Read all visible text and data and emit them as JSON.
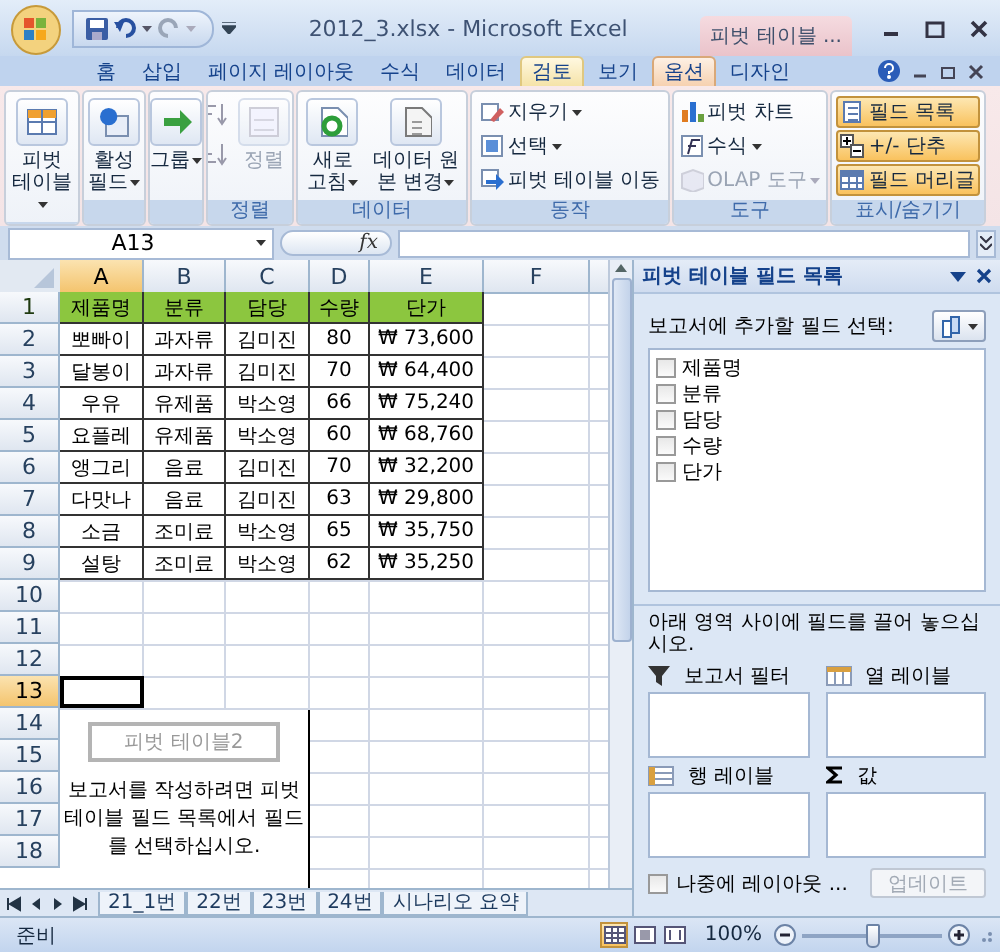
{
  "title_bar": {
    "title": "2012_3.xlsx - Microsoft Excel",
    "context_tab_label": "피벗 테이블 ..."
  },
  "ribbon": {
    "tabs": [
      {
        "label": "홈",
        "selected": false,
        "hovered": false
      },
      {
        "label": "삽입",
        "selected": false,
        "hovered": false
      },
      {
        "label": "페이지 레이아웃",
        "selected": false,
        "hovered": false
      },
      {
        "label": "수식",
        "selected": false,
        "hovered": false
      },
      {
        "label": "데이터",
        "selected": false,
        "hovered": false
      },
      {
        "label": "검토",
        "selected": false,
        "hovered": true
      },
      {
        "label": "보기",
        "selected": false,
        "hovered": false
      },
      {
        "label": "옵션",
        "selected": true,
        "hovered": false
      },
      {
        "label": "디자인",
        "selected": false,
        "hovered": false
      }
    ],
    "groups": [
      {
        "items": [
          {
            "kind": "large",
            "label": "피벗 테이블",
            "dropdown": true,
            "disabled": false,
            "on": false
          }
        ]
      },
      {
        "items": [
          {
            "kind": "large",
            "label": "활성 필드",
            "dropdown": true,
            "disabled": false,
            "on": false
          }
        ]
      },
      {
        "items": [
          {
            "kind": "large",
            "label": "그룹",
            "dropdown": true,
            "disabled": false,
            "on": false
          }
        ]
      },
      {
        "label": "정렬",
        "items": [
          {
            "kind": "sort",
            "label": "정렬",
            "dropdown": false,
            "disabled": true,
            "on": false
          }
        ]
      },
      {
        "label": "데이터",
        "items": [
          {
            "kind": "large",
            "label": "새로 고침",
            "dropdown": true,
            "disabled": false,
            "on": false
          },
          {
            "kind": "large",
            "label": "데이터 원본 변경",
            "dropdown": true,
            "disabled": false,
            "on": false
          }
        ]
      },
      {
        "label": "동작",
        "items": [
          {
            "kind": "small",
            "label": "지우기",
            "dropdown": true,
            "disabled": false,
            "on": false
          },
          {
            "kind": "small",
            "label": "선택",
            "dropdown": true,
            "disabled": false,
            "on": false
          },
          {
            "kind": "small",
            "label": "피벗 테이블 이동",
            "dropdown": false,
            "disabled": false,
            "on": false
          }
        ]
      },
      {
        "label": "도구",
        "items": [
          {
            "kind": "small",
            "label": "피벗 차트",
            "dropdown": false,
            "disabled": false,
            "on": false
          },
          {
            "kind": "small",
            "label": "수식",
            "dropdown": true,
            "disabled": false,
            "on": false
          },
          {
            "kind": "small",
            "label": "OLAP 도구",
            "dropdown": true,
            "disabled": true,
            "on": false
          }
        ]
      },
      {
        "label": "표시/숨기기",
        "items": [
          {
            "kind": "small",
            "label": "필드 목록",
            "dropdown": false,
            "disabled": false,
            "on": true
          },
          {
            "kind": "small",
            "label": "+/- 단추",
            "dropdown": false,
            "disabled": false,
            "on": true
          },
          {
            "kind": "small",
            "label": "필드 머리글",
            "dropdown": false,
            "disabled": false,
            "on": true
          }
        ]
      }
    ]
  },
  "formula_bar": {
    "name_box": "A13",
    "fx": "fx"
  },
  "sheet": {
    "columns": [
      {
        "label": "A",
        "selected": true
      },
      {
        "label": "B",
        "selected": false
      },
      {
        "label": "C",
        "selected": false
      },
      {
        "label": "D",
        "selected": false
      },
      {
        "label": "E",
        "selected": false
      },
      {
        "label": "F",
        "selected": false
      }
    ],
    "rows": [
      {
        "number": "1",
        "selected": false,
        "header": true,
        "cells": [
          "제품명",
          "분류",
          "담당",
          "수량",
          "단가"
        ]
      },
      {
        "number": "2",
        "selected": false,
        "header": false,
        "cells": [
          "뽀빠이",
          "과자류",
          "김미진",
          "80",
          "₩ 73,600"
        ]
      },
      {
        "number": "3",
        "selected": false,
        "header": false,
        "cells": [
          "달봉이",
          "과자류",
          "김미진",
          "70",
          "₩ 64,400"
        ]
      },
      {
        "number": "4",
        "selected": false,
        "header": false,
        "cells": [
          "우유",
          "유제품",
          "박소영",
          "66",
          "₩ 75,240"
        ]
      },
      {
        "number": "5",
        "selected": false,
        "header": false,
        "cells": [
          "요플레",
          "유제품",
          "박소영",
          "60",
          "₩ 68,760"
        ]
      },
      {
        "number": "6",
        "selected": false,
        "header": false,
        "cells": [
          "앵그리",
          "음료",
          "김미진",
          "70",
          "₩ 32,200"
        ]
      },
      {
        "number": "7",
        "selected": false,
        "header": false,
        "cells": [
          "다맛나",
          "음료",
          "김미진",
          "63",
          "₩ 29,800"
        ]
      },
      {
        "number": "8",
        "selected": false,
        "header": false,
        "cells": [
          "소금",
          "조미료",
          "박소영",
          "65",
          "₩ 35,750"
        ]
      },
      {
        "number": "9",
        "selected": false,
        "header": false,
        "cells": [
          "설탕",
          "조미료",
          "박소영",
          "62",
          "₩ 35,250"
        ]
      },
      {
        "number": "10",
        "selected": false,
        "header": false
      },
      {
        "number": "11",
        "selected": false,
        "header": false
      },
      {
        "number": "12",
        "selected": false,
        "header": false
      },
      {
        "number": "13",
        "selected": true,
        "header": false
      },
      {
        "number": "14",
        "selected": false,
        "header": false
      },
      {
        "number": "15",
        "selected": false,
        "header": false
      },
      {
        "number": "16",
        "selected": false,
        "header": false
      },
      {
        "number": "17",
        "selected": false,
        "header": false
      },
      {
        "number": "18",
        "selected": false,
        "header": false
      }
    ],
    "pivot_placeholder": {
      "title": "피벗 테이블2",
      "message": "보고서를 작성하려면 피벗 테이블 필드 목록에서 필드를 선택하십시오."
    },
    "sheet_tabs": [
      {
        "label": "21_1번",
        "selected": false
      },
      {
        "label": "22번",
        "selected": false
      },
      {
        "label": "23번",
        "selected": false
      },
      {
        "label": "24번",
        "selected": false
      },
      {
        "label": "시나리오 요약",
        "selected": false
      }
    ]
  },
  "field_list": {
    "title": "피벗 테이블 필드 목록",
    "prompt": "보고서에 추가할 필드 선택:",
    "fields": [
      {
        "label": "제품명",
        "checked": false
      },
      {
        "label": "분류",
        "checked": false
      },
      {
        "label": "담당",
        "checked": false
      },
      {
        "label": "수량",
        "checked": false
      },
      {
        "label": "단가",
        "checked": false
      }
    ],
    "instruction": "아래 영역 사이에 필드를 끌어 놓으십시오.",
    "areas": [
      {
        "kind": "filter",
        "label": "보고서 필터"
      },
      {
        "kind": "column",
        "label": "열 레이블"
      },
      {
        "kind": "row",
        "label": "행 레이블"
      },
      {
        "kind": "values",
        "label": "값"
      }
    ],
    "defer": {
      "label": "나중에 레이아웃 ...",
      "checked": false
    },
    "update_button": {
      "label": "업데이트",
      "disabled": true
    }
  },
  "status_bar": {
    "status": "준비",
    "views": [
      {
        "selected": true
      },
      {
        "selected": false
      },
      {
        "selected": false
      }
    ],
    "zoom": "100%",
    "zoom_slider": {
      "level": 0.5
    }
  }
}
